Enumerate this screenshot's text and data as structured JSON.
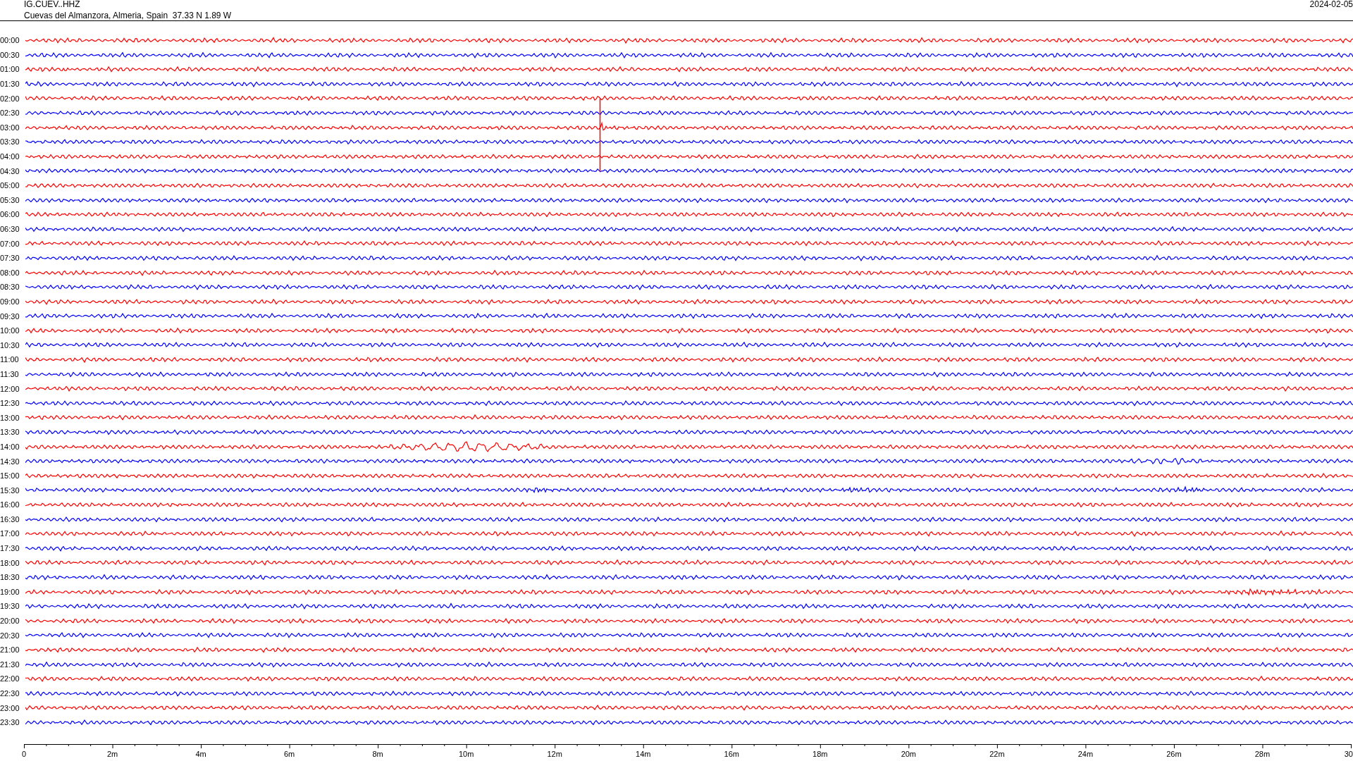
{
  "header": {
    "station": "IG.CUEV..HHZ",
    "location": "Cuevas del Almanzora, Almeria, Spain  37.33 N 1.89 W",
    "date": "2024-02-05"
  },
  "traces": [
    {
      "time": "00:00",
      "color": "#ff0000"
    },
    {
      "time": "00:30",
      "color": "#0000ff"
    },
    {
      "time": "01:00",
      "color": "#ff0000"
    },
    {
      "time": "01:30",
      "color": "#0000ff"
    },
    {
      "time": "02:00",
      "color": "#ff0000"
    },
    {
      "time": "02:30",
      "color": "#0000ff"
    },
    {
      "time": "03:00",
      "color": "#ff0000"
    },
    {
      "time": "03:30",
      "color": "#0000ff"
    },
    {
      "time": "04:00",
      "color": "#ff0000"
    },
    {
      "time": "04:30",
      "color": "#0000ff"
    },
    {
      "time": "05:00",
      "color": "#ff0000"
    },
    {
      "time": "05:30",
      "color": "#0000ff"
    },
    {
      "time": "06:00",
      "color": "#ff0000"
    },
    {
      "time": "06:30",
      "color": "#0000ff"
    },
    {
      "time": "07:00",
      "color": "#ff0000"
    },
    {
      "time": "07:30",
      "color": "#0000ff"
    },
    {
      "time": "08:00",
      "color": "#ff0000"
    },
    {
      "time": "08:30",
      "color": "#0000ff"
    },
    {
      "time": "09:00",
      "color": "#ff0000"
    },
    {
      "time": "09:30",
      "color": "#0000ff"
    },
    {
      "time": "10:00",
      "color": "#ff0000"
    },
    {
      "time": "10:30",
      "color": "#0000ff"
    },
    {
      "time": "11:00",
      "color": "#ff0000"
    },
    {
      "time": "11:30",
      "color": "#0000ff"
    },
    {
      "time": "12:00",
      "color": "#ff0000"
    },
    {
      "time": "12:30",
      "color": "#0000ff"
    },
    {
      "time": "13:00",
      "color": "#ff0000"
    },
    {
      "time": "13:30",
      "color": "#0000ff"
    },
    {
      "time": "14:00",
      "color": "#ff0000"
    },
    {
      "time": "14:30",
      "color": "#0000ff"
    },
    {
      "time": "15:00",
      "color": "#ff0000"
    },
    {
      "time": "15:30",
      "color": "#0000ff"
    },
    {
      "time": "16:00",
      "color": "#ff0000"
    },
    {
      "time": "16:30",
      "color": "#0000ff"
    },
    {
      "time": "17:00",
      "color": "#ff0000"
    },
    {
      "time": "17:30",
      "color": "#0000ff"
    },
    {
      "time": "18:00",
      "color": "#ff0000"
    },
    {
      "time": "18:30",
      "color": "#0000ff"
    },
    {
      "time": "19:00",
      "color": "#ff0000"
    },
    {
      "time": "19:30",
      "color": "#0000ff"
    },
    {
      "time": "20:00",
      "color": "#ff0000"
    },
    {
      "time": "20:30",
      "color": "#0000ff"
    },
    {
      "time": "21:00",
      "color": "#ff0000"
    },
    {
      "time": "21:30",
      "color": "#0000ff"
    },
    {
      "time": "22:00",
      "color": "#ff0000"
    },
    {
      "time": "22:30",
      "color": "#0000ff"
    },
    {
      "time": "23:00",
      "color": "#ff0000"
    },
    {
      "time": "23:30",
      "color": "#0000ff"
    }
  ],
  "axis": {
    "labels": [
      "0",
      "2m",
      "4m",
      "6m",
      "8m",
      "10m",
      "12m",
      "14m",
      "16m",
      "18m",
      "20m",
      "22m",
      "24m",
      "26m",
      "28m",
      "30"
    ]
  }
}
